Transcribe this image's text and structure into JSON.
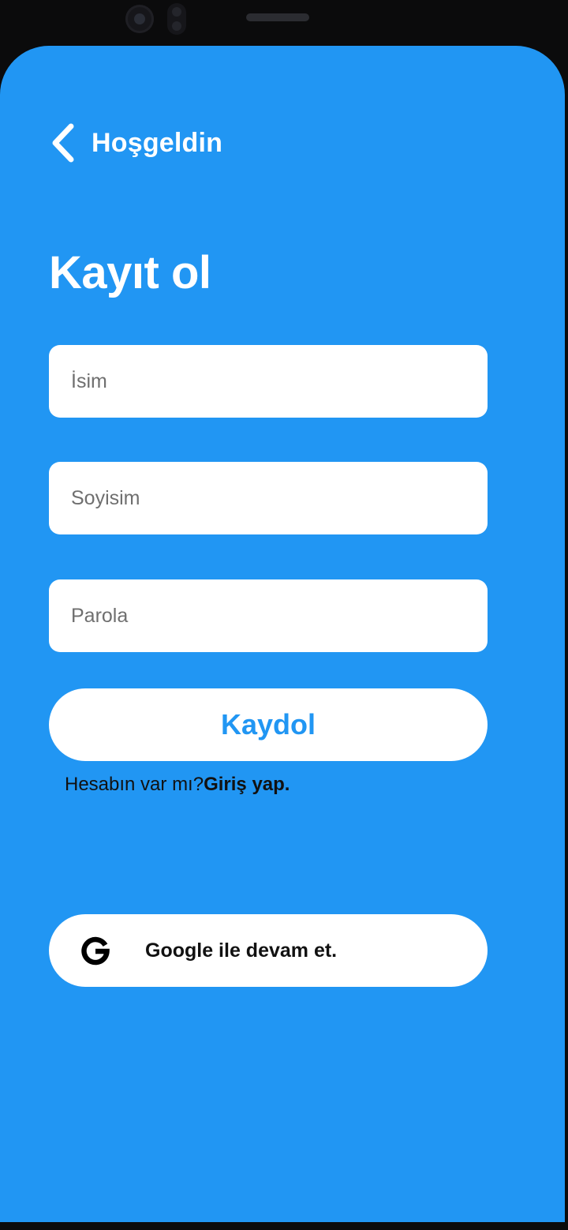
{
  "header": {
    "back_icon": "chevron-left-icon",
    "title": "Hoşgeldin"
  },
  "page": {
    "title": "Kayıt ol"
  },
  "form": {
    "name_placeholder": "İsim",
    "surname_placeholder": "Soyisim",
    "password_placeholder": "Parola",
    "name_value": "",
    "surname_value": "",
    "password_value": ""
  },
  "register_button": {
    "label": "Kaydol"
  },
  "login_prompt": {
    "text": "Hesabın var mı?",
    "link": "Giriş yap."
  },
  "google_button": {
    "icon": "google-icon",
    "label": "Google ile devam et."
  },
  "colors": {
    "background": "#2196f3",
    "accent": "#2196f3",
    "surface": "#ffffff",
    "text_dark": "#111111"
  }
}
